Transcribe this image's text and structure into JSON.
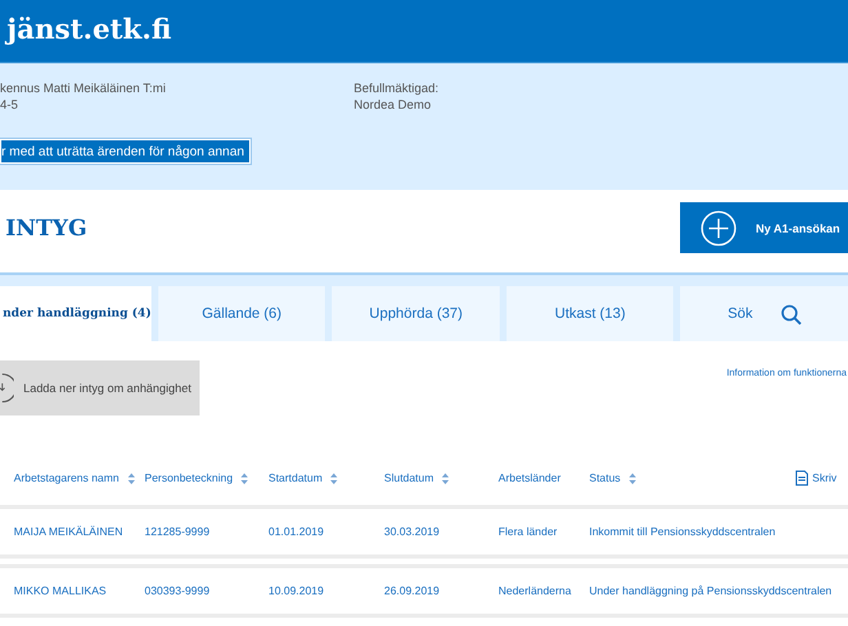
{
  "header": {
    "title": "jänst.etk.fi"
  },
  "account": {
    "company": "kennus Matti Meikäläinen T:mi",
    "company_id": "4-5",
    "authorized_label": "Befullmäktigad:",
    "authorized_name": "Nordea Demo",
    "switch_button": "r med att uträtta ärenden för någon annan"
  },
  "page": {
    "title": "INTYG",
    "new_button": "Ny A1-ansökan"
  },
  "tabs": [
    {
      "label": "nder handläggning (4)",
      "selected": true,
      "kind": "text"
    },
    {
      "label": "Gällande (6)",
      "selected": false,
      "kind": "text"
    },
    {
      "label": "Upphörda (37)",
      "selected": false,
      "kind": "text"
    },
    {
      "label": "Utkast (13)",
      "selected": false,
      "kind": "text"
    },
    {
      "label": "Sök",
      "selected": false,
      "kind": "search"
    }
  ],
  "download_button": "Ladda ner intyg om anhängighet",
  "info_link": "Information om funktionerna",
  "table": {
    "columns": [
      {
        "label": "Arbetstagarens namn",
        "sortable": true
      },
      {
        "label": "Personbeteckning",
        "sortable": true
      },
      {
        "label": "Startdatum",
        "sortable": true
      },
      {
        "label": "Slutdatum",
        "sortable": true
      },
      {
        "label": "Arbetsländer",
        "sortable": false
      },
      {
        "label": "Status",
        "sortable": true
      }
    ],
    "print_link": "Skriv",
    "rows": [
      [
        "MAIJA MEIKÄLÄINEN",
        "121285-9999",
        "01.01.2019",
        "30.03.2019",
        "Flera länder",
        "Inkommit till Pensionsskyddscentralen"
      ],
      [
        "MIKKO MALLIKAS",
        "030393-9999",
        "10.09.2019",
        "26.09.2019",
        "Nederländerna",
        "Under handläggning på Pensionsskyddscentralen"
      ]
    ]
  }
}
